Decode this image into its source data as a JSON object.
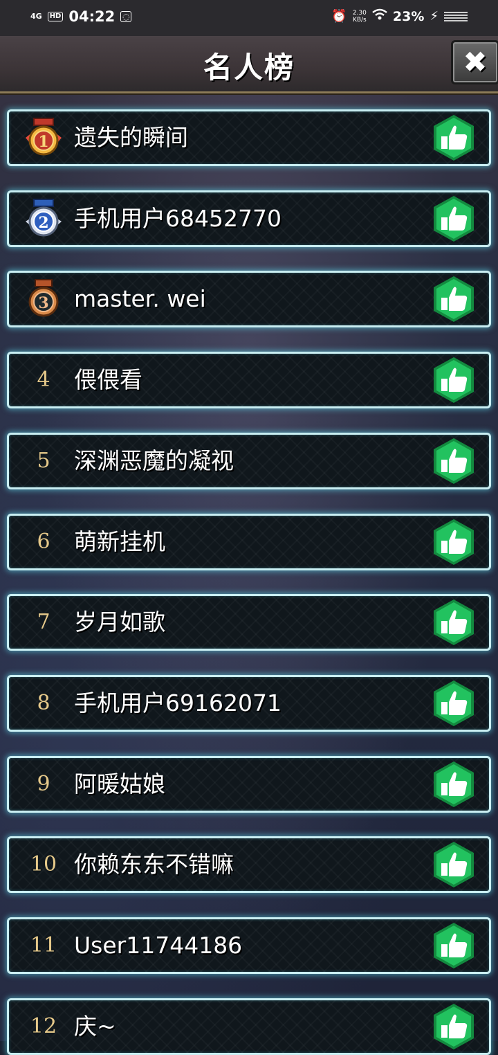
{
  "status_bar": {
    "network": "4G",
    "hd": "HD",
    "time": "04:22",
    "speed_value": "2.30",
    "speed_unit": "KB/s",
    "battery": "23%"
  },
  "header": {
    "title": "名人榜",
    "close_icon": "close-icon"
  },
  "leaderboard": {
    "rows": [
      {
        "rank": "1",
        "name": "遗失的瞬间",
        "medal": "gold"
      },
      {
        "rank": "2",
        "name": "手机用户68452770",
        "medal": "silver"
      },
      {
        "rank": "3",
        "name": "master. wei",
        "medal": "bronze"
      },
      {
        "rank": "4",
        "name": "偎偎看"
      },
      {
        "rank": "5",
        "name": "深渊恶魔的凝视"
      },
      {
        "rank": "6",
        "name": "萌新挂机"
      },
      {
        "rank": "7",
        "name": "岁月如歌"
      },
      {
        "rank": "8",
        "name": "手机用户69162071"
      },
      {
        "rank": "9",
        "name": "阿暖姑娘"
      },
      {
        "rank": "10",
        "name": "你赖东东不错嘛"
      },
      {
        "rank": "11",
        "name": "User11744186"
      },
      {
        "rank": "12",
        "name": "庆~"
      }
    ],
    "like_icon": "thumbs-up-icon",
    "colors": {
      "like_green": "#1fb85a",
      "row_border": "#c9eef2",
      "rank_gold": "#e6c98a"
    }
  }
}
